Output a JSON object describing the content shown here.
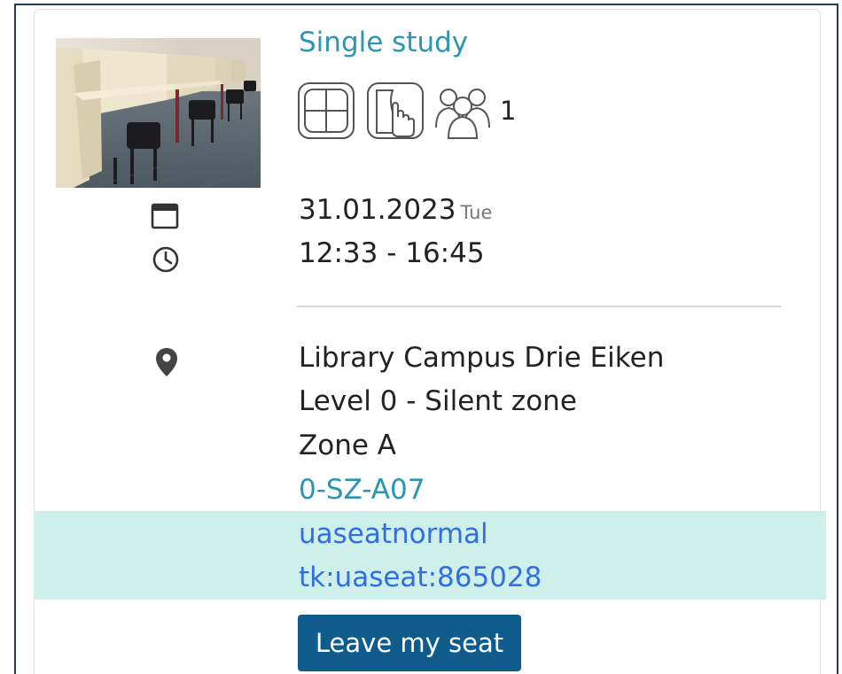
{
  "space": {
    "title": "Single study",
    "image_alt": "study-desks-photo",
    "features": [
      {
        "icon": "window-icon"
      },
      {
        "icon": "touch-screen-icon"
      },
      {
        "icon": "people-icon"
      }
    ],
    "capacity": "1"
  },
  "booking": {
    "date": "31.01.2023",
    "weekday": "Tue",
    "time_range": "12:33 - 16:45"
  },
  "location": {
    "building": "Library Campus Drie Eiken",
    "level": "Level 0 - Silent zone",
    "zone": "Zone A",
    "seat_code": "0-SZ-A07"
  },
  "seat_meta": {
    "type": "uaseatnormal",
    "id": "tk:uaseat:865028"
  },
  "actions": {
    "leave_label": "Leave my seat"
  },
  "colors": {
    "accent": "#2b96b3",
    "link": "#2f6fe3",
    "button": "#0f5c8c",
    "highlight": "#cff0ea"
  }
}
